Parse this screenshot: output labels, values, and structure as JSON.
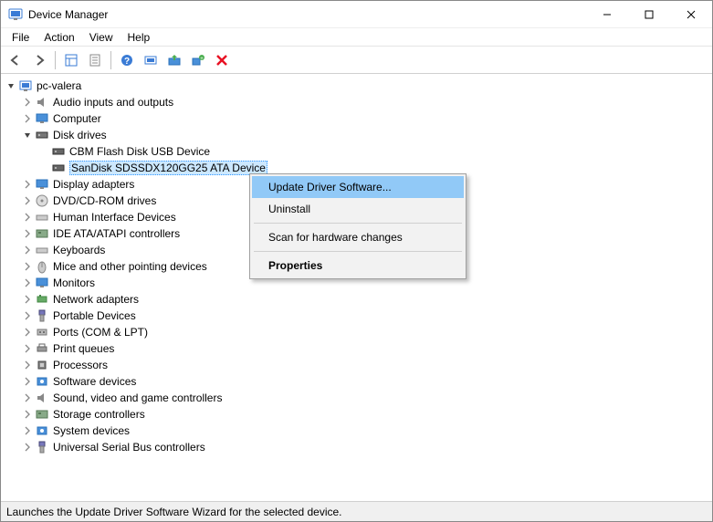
{
  "window": {
    "title": "Device Manager"
  },
  "menubar": [
    "File",
    "Action",
    "View",
    "Help"
  ],
  "tree": {
    "root": "pc-valera",
    "categories": [
      {
        "label": "Audio inputs and outputs",
        "expanded": false
      },
      {
        "label": "Computer",
        "expanded": false
      },
      {
        "label": "Disk drives",
        "expanded": true,
        "children": [
          {
            "label": "CBM Flash Disk USB Device"
          },
          {
            "label": "SanDisk SDSSDX120GG25 ATA Device",
            "selected": true
          }
        ]
      },
      {
        "label": "Display adapters",
        "expanded": false
      },
      {
        "label": "DVD/CD-ROM drives",
        "expanded": false
      },
      {
        "label": "Human Interface Devices",
        "expanded": false
      },
      {
        "label": "IDE ATA/ATAPI controllers",
        "expanded": false
      },
      {
        "label": "Keyboards",
        "expanded": false
      },
      {
        "label": "Mice and other pointing devices",
        "expanded": false
      },
      {
        "label": "Monitors",
        "expanded": false
      },
      {
        "label": "Network adapters",
        "expanded": false
      },
      {
        "label": "Portable Devices",
        "expanded": false
      },
      {
        "label": "Ports (COM & LPT)",
        "expanded": false
      },
      {
        "label": "Print queues",
        "expanded": false
      },
      {
        "label": "Processors",
        "expanded": false
      },
      {
        "label": "Software devices",
        "expanded": false
      },
      {
        "label": "Sound, video and game controllers",
        "expanded": false
      },
      {
        "label": "Storage controllers",
        "expanded": false
      },
      {
        "label": "System devices",
        "expanded": false
      },
      {
        "label": "Universal Serial Bus controllers",
        "expanded": false
      }
    ]
  },
  "contextmenu": {
    "items": [
      {
        "label": "Update Driver Software...",
        "highlight": true
      },
      {
        "label": "Uninstall"
      },
      {
        "sep": true
      },
      {
        "label": "Scan for hardware changes"
      },
      {
        "sep": true
      },
      {
        "label": "Properties",
        "bold": true
      }
    ]
  },
  "statusbar": "Launches the Update Driver Software Wizard for the selected device."
}
